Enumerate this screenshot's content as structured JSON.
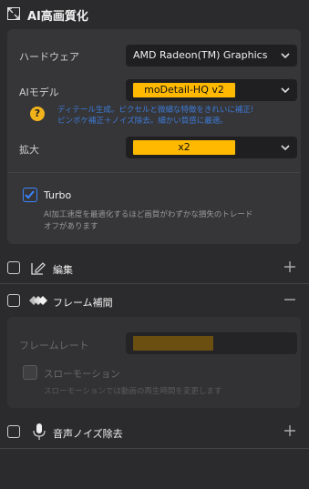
{
  "header": {
    "title": "AI高画質化"
  },
  "ai_panel": {
    "hardware_label": "ハードウェア",
    "hardware_value": "AMD Radeon(TM) Graphics",
    "model_label": "AIモデル",
    "model_value": "moDetail-HQ v2",
    "model_desc_line1": "ディテール生成。ピクセルと微細な特徴をきれいに補正!",
    "model_desc_line2": "ピンボケ補正＋ノイズ除去。細かい質感に最適。",
    "scale_label": "拡大",
    "scale_value": "x2",
    "turbo_label": "Turbo",
    "turbo_desc_line1": "AI加工速度を最適化するほど画質がわずかな損失のトレード",
    "turbo_desc_line2": "オフがあります"
  },
  "edit_row": {
    "label": "編集"
  },
  "frame_row": {
    "label": "フレーム補間"
  },
  "frame_panel": {
    "framerate_label": "フレームレート",
    "slowmo_label": "スローモーション",
    "slowmo_desc": "スローモーションでは動画の再生時間を変更します"
  },
  "denoise_row": {
    "label": "音声ノイズ除去"
  },
  "colors": {
    "accent": "#ffb900",
    "link_blue": "#3d7bd9",
    "checkbox_blue": "#3a86ff"
  }
}
